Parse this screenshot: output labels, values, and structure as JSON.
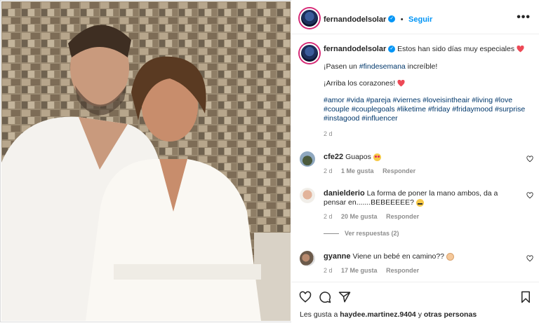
{
  "header": {
    "username": "fernandodelsolar",
    "follow_label": "Seguir",
    "more_label": "•••"
  },
  "caption": {
    "username": "fernandodelsolar",
    "line1": "Estos han sido días muy especiales",
    "line2_pre": "¡Pasen un ",
    "line2_tag": "#findesemana",
    "line2_post": " increíble!",
    "line3": "¡Arriba los corazones!",
    "hashtags": "#amor #vida #pareja #viernes #loveisintheair #living #love #couple #couplegoals #liketime #friday #fridaymood #surprise #instagood #influencer",
    "time": "2 d"
  },
  "comments": [
    {
      "username": "cfe22",
      "text": "Guapos",
      "time": "2 d",
      "likes": "1 Me gusta",
      "reply": "Responder"
    },
    {
      "username": "danielderio",
      "text": "La forma de poner la mano ambos, da a pensar en.......BEBEEEEE?",
      "time": "2 d",
      "likes": "20 Me gusta",
      "reply": "Responder",
      "view_replies": "Ver respuestas (2)"
    },
    {
      "username": "gyanne",
      "text": "Viene un bebé en camino??",
      "time": "2 d",
      "likes": "17 Me gusta",
      "reply": "Responder"
    }
  ],
  "likes": {
    "prefix": "Les gusta a ",
    "user": "haydee.martinez.9404",
    "middle": " y ",
    "others": "otras personas"
  },
  "colors": {
    "accent": "#0095f6",
    "heart": "#ed4956",
    "hashtag": "#00376b"
  }
}
